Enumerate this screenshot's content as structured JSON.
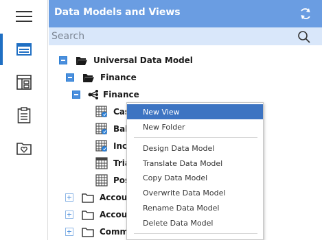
{
  "rail": {
    "items": [
      {
        "name": "menu-icon"
      },
      {
        "name": "data-models-icon"
      },
      {
        "name": "dashboard-layout-icon"
      },
      {
        "name": "clipboard-icon"
      },
      {
        "name": "favorites-folder-icon"
      }
    ],
    "active_index": 1,
    "accent": "#1f6fc3"
  },
  "header": {
    "title": "Data Models and Views",
    "background": "#6a9de2"
  },
  "search": {
    "placeholder": "Search",
    "value": ""
  },
  "tree": {
    "root": "Universal Data Model",
    "finance_folder": "Finance",
    "finance_model": "Finance",
    "views": [
      "Cas",
      "Bala",
      "Inco",
      "Tria",
      "Pos"
    ],
    "folders": [
      "Accoun",
      "Accoun",
      "Commo"
    ]
  },
  "context_menu": {
    "new_view": "New View",
    "new_folder": "New Folder",
    "design": "Design Data Model",
    "translate": "Translate Data Model",
    "copy": "Copy Data Model",
    "overwrite": "Overwrite Data Model",
    "rename": "Rename Data Model",
    "delete": "Delete Data Model",
    "highlight_color": "#3d74c2"
  }
}
